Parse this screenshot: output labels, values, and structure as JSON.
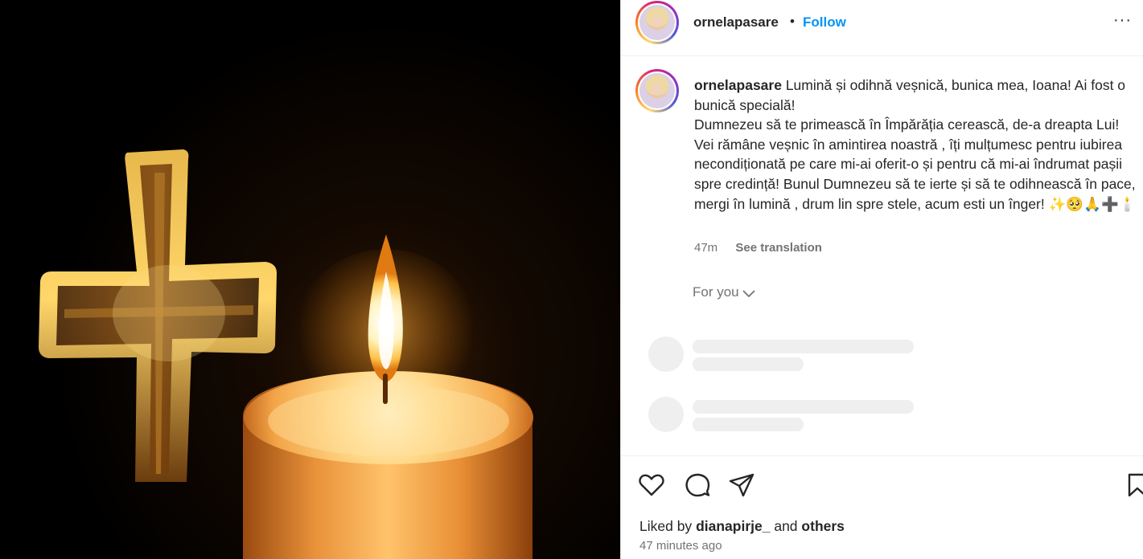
{
  "post": {
    "username": "ornelapasare",
    "separator": "•",
    "follow_label": "Follow",
    "more_label": "···",
    "caption": {
      "username": "ornelapasare",
      "text": "Lumină și odihnă veșnică, bunica mea, Ioana! Ai fost o bunică specială!\nDumnezeu să te primească în Împărăția cerească, de-a dreapta Lui! Vei rămâne veșnic în amintirea noastră , îți mulțumesc pentru iubirea necondiționată pe care mi-ai oferit-o și pentru că mi-ai îndrumat pașii spre credință! Bunul Dumnezeu să te ierte și să te odihnească în pace, mergi în lumină , drum lin spre stele, acum esti un înger! ✨🥺🙏➕🕯️"
    },
    "caption_age": "47m",
    "see_translation": "See translation",
    "for_you_label": "For you",
    "liked_by_prefix": "Liked by",
    "liked_by_user": "dianapirje_",
    "liked_by_and": "and",
    "liked_by_others": "others",
    "posted_ago": "47 minutes ago"
  },
  "icons": {
    "like": "heart-icon",
    "comment": "comment-icon",
    "share": "send-icon",
    "save": "bookmark-icon",
    "more": "more-icon",
    "chevron": "chevron-down-icon"
  },
  "colors": {
    "link_blue": "#0095f6",
    "text_primary": "#262626",
    "text_secondary": "#737373",
    "skeleton": "#efefef"
  }
}
